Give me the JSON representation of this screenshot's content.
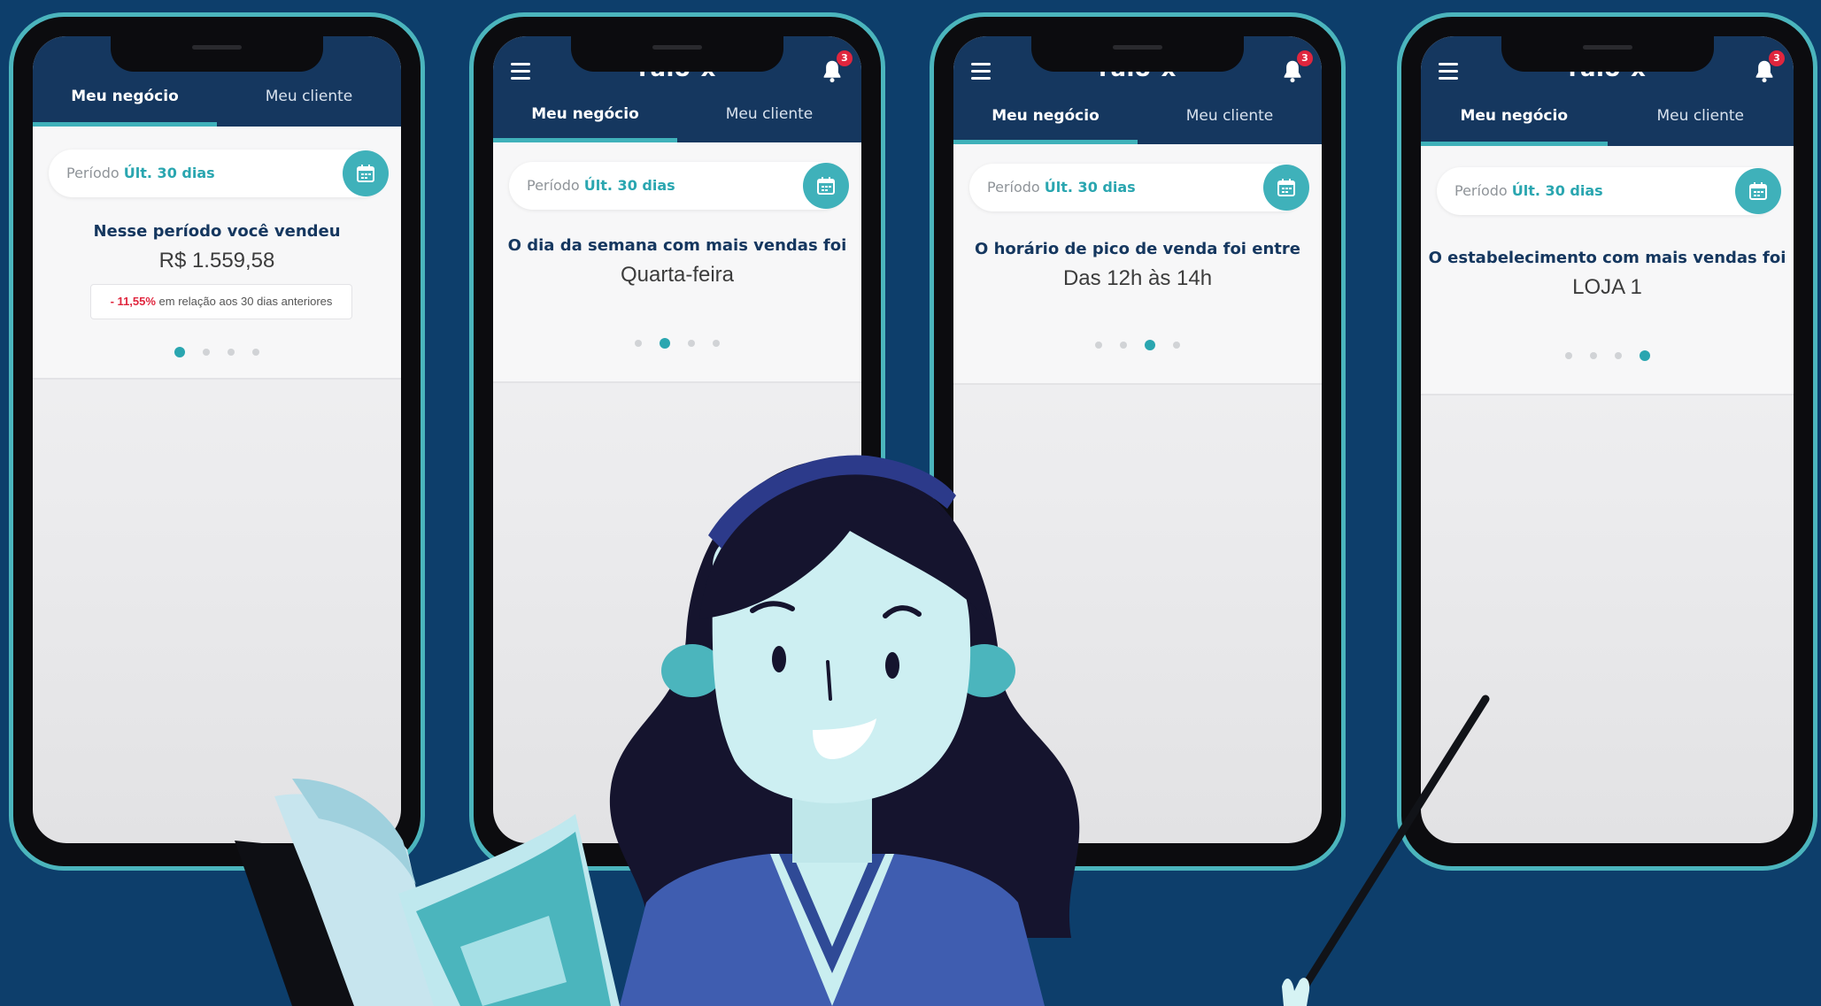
{
  "colors": {
    "background": "#0d3e6b",
    "header": "#15375f",
    "accent": "#3fb1ba",
    "negative": "#e0263e"
  },
  "app": {
    "logo": "raio-x",
    "notification_count": "3"
  },
  "tabs": {
    "business": "Meu negócio",
    "customer": "Meu cliente"
  },
  "period": {
    "label": "Período",
    "value": "Últ. 30 dias"
  },
  "screens": [
    {
      "headline": "Nesse período você vendeu",
      "value": "R$ 1.559,58",
      "comparison": {
        "change": "- 11,55%",
        "text": " em relação aos 30 dias anteriores"
      },
      "active_slide": 1
    },
    {
      "headline": "O dia da semana com mais vendas foi",
      "value": "Quarta-feira",
      "active_slide": 2
    },
    {
      "headline": "O horário de pico de venda foi entre",
      "value": "Das 12h às 14h",
      "active_slide": 3
    },
    {
      "headline": "O estabelecimento com mais vendas foi",
      "value": "LOJA 1",
      "active_slide": 4
    }
  ],
  "icons": [
    "menu-icon",
    "bell-icon",
    "calendar-icon"
  ]
}
